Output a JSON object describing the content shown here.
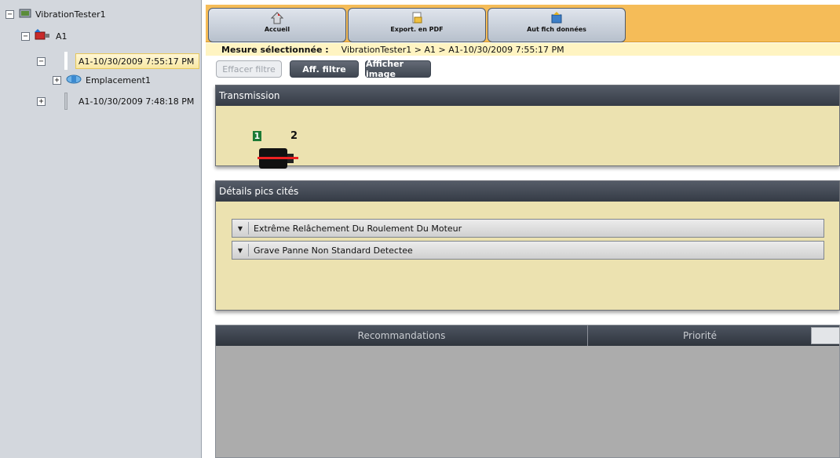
{
  "tree": {
    "root": "VibrationTester1",
    "machine": "A1",
    "measure_selected": "A1-10/30/2009 7:55:17 PM",
    "location": "Emplacement1",
    "measure_other": "A1-10/30/2009 7:48:18 PM",
    "expand_minus": "−",
    "expand_plus": "+"
  },
  "toolbar": {
    "home": "Accueil",
    "export_pdf": "Export. en PDF",
    "data_files": "Aut fich données"
  },
  "breadcrumb": {
    "label": "Mesure sélectionnée :",
    "path": "VibrationTester1 > A1 > A1-10/30/2009 7:55:17 PM"
  },
  "filters": {
    "clear": "Effacer filtre",
    "show": "Aff. filtre",
    "image": "Afficher image"
  },
  "transmission": {
    "title": "Transmission",
    "marker_1": "1",
    "marker_2": "2"
  },
  "details": {
    "title": "Détails pics cités",
    "items": [
      "Extrême Relâchement Du Roulement Du Moteur",
      "Grave Panne Non Standard Detectee"
    ]
  },
  "recommendations": {
    "col_recommendation": "Recommandations",
    "col_priority": "Priorité"
  },
  "colors": {
    "toolbar_bg": "#f5bc58",
    "panel_bg": "#ece2b0",
    "header_dark": "#353b45",
    "tree_bg": "#d3d7dd",
    "marker_green": "#1c7a35"
  }
}
